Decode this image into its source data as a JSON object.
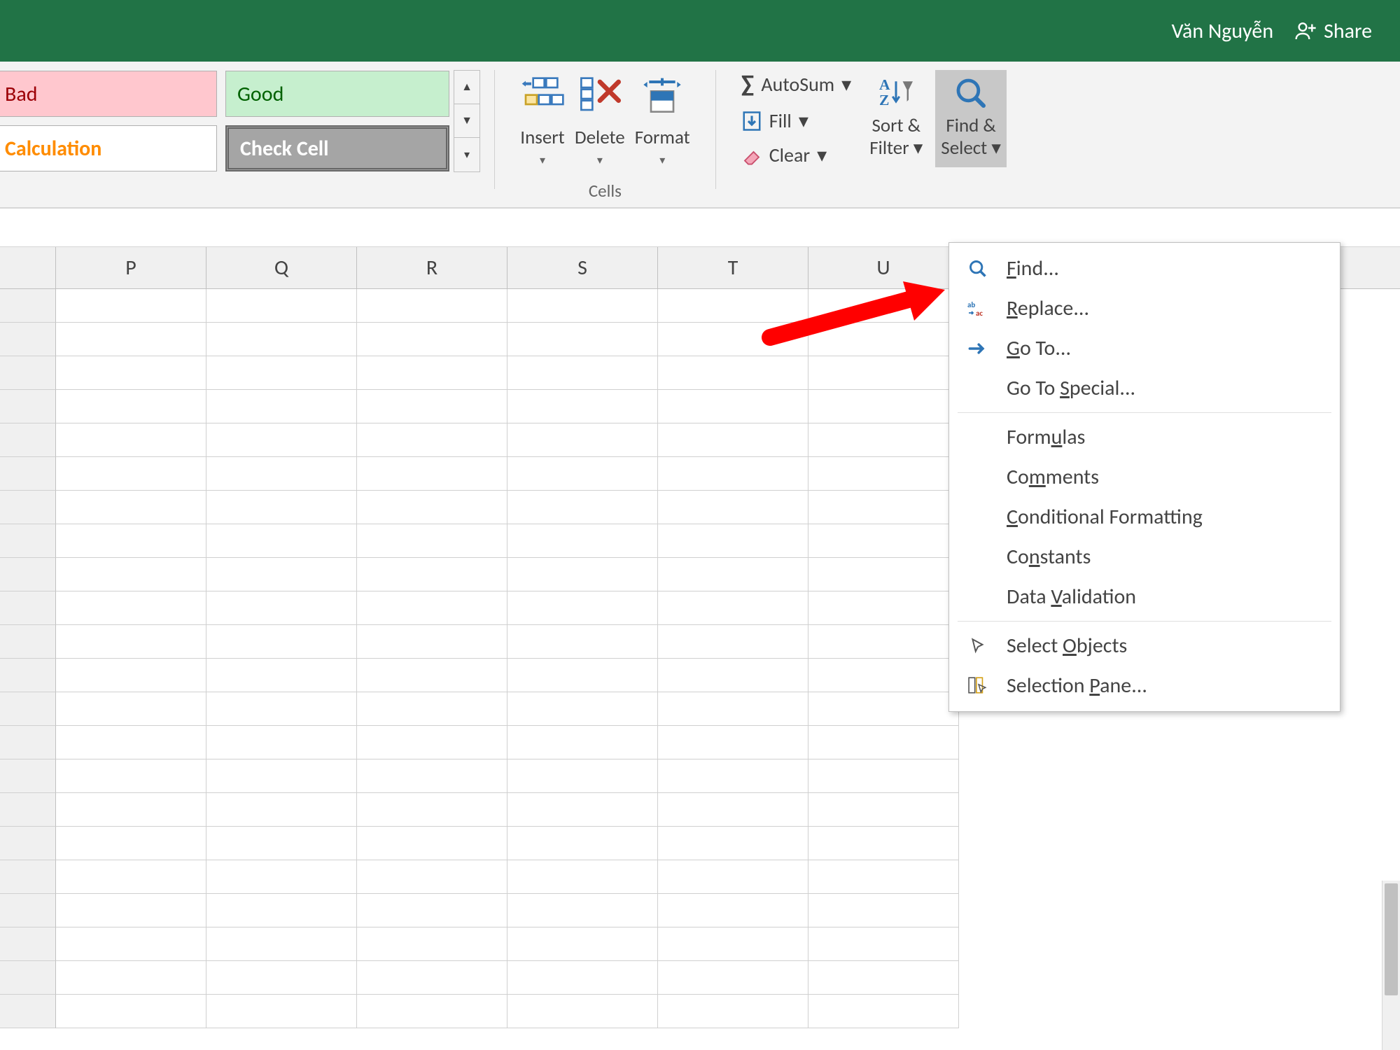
{
  "titlebar": {
    "user_name": "Văn Nguyễn",
    "share_label": "Share"
  },
  "styles": {
    "bad": "Bad",
    "good": "Good",
    "calculation": "Calculation",
    "check_cell": "Check Cell"
  },
  "cells_group": {
    "insert": "Insert",
    "delete": "Delete",
    "format": "Format",
    "label": "Cells"
  },
  "editing": {
    "autosum": "AutoSum",
    "fill": "Fill",
    "clear": "Clear",
    "sort_filter_l1": "Sort &",
    "sort_filter_l2": "Filter",
    "find_select_l1": "Find &",
    "find_select_l2": "Select"
  },
  "menu": {
    "find": "Find...",
    "replace": "Replace...",
    "goto": "Go To...",
    "goto_special": "Go To Special...",
    "formulas": "Formulas",
    "comments": "Comments",
    "cond_fmt": "Conditional Formatting",
    "constants": "Constants",
    "data_val": "Data Validation",
    "select_objects": "Select Objects",
    "selection_pane": "Selection Pane..."
  },
  "columns": [
    "P",
    "Q",
    "R",
    "S",
    "T",
    "U"
  ]
}
